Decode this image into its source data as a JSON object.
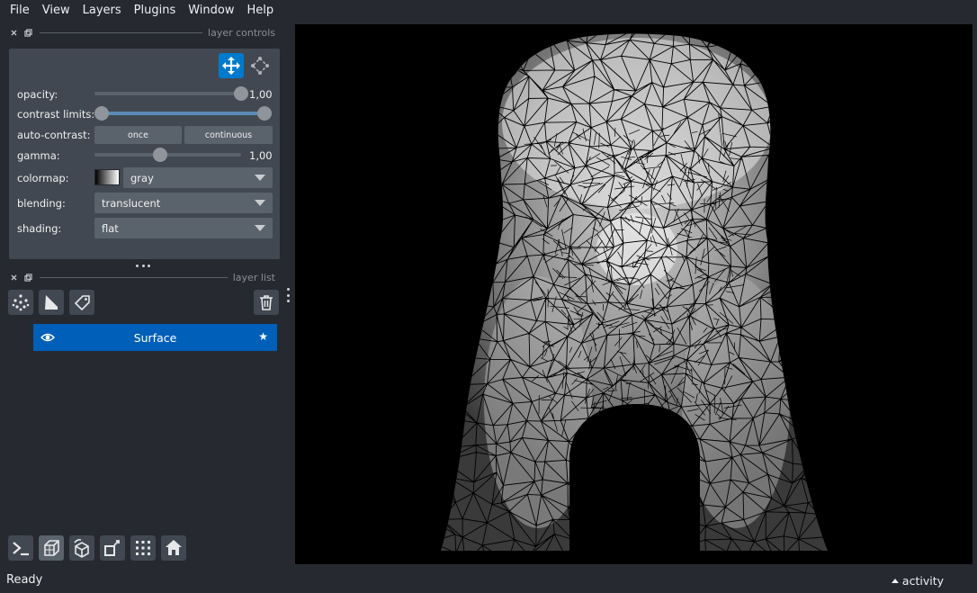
{
  "menu": [
    "File",
    "View",
    "Layers",
    "Plugins",
    "Window",
    "Help"
  ],
  "layer_controls": {
    "header": "layer controls",
    "opacity_label": "opacity:",
    "opacity_value": "1,00",
    "opacity_level": 1.0,
    "contrast_label": "contrast limits:",
    "contrast_range": [
      0.0,
      1.0
    ],
    "auto_contrast_label": "auto-contrast:",
    "once_label": "once",
    "continuous_label": "continuous",
    "gamma_label": "gamma:",
    "gamma_value": "1,00",
    "gamma_level": 0.45,
    "colormap_label": "colormap:",
    "colormap_value": "gray",
    "blending_label": "blending:",
    "blending_value": "translucent",
    "shading_label": "shading:",
    "shading_value": "flat"
  },
  "layer_list": {
    "header": "layer list",
    "layers": [
      {
        "name": "Surface",
        "visible": true,
        "selected": true
      }
    ]
  },
  "status": {
    "text": "Ready",
    "activity_label": "activity"
  },
  "colors": {
    "background": "#262930",
    "panel": "#414851",
    "accent": "#007acc",
    "selected_layer": "#005fb8",
    "canvas": "#000000"
  },
  "icons": {
    "toolbar_top": [
      "move-camera-icon",
      "transform-icon"
    ],
    "layer_buttons": [
      "new-points-icon",
      "new-shapes-icon",
      "new-labels-icon",
      "delete-layer-icon"
    ],
    "bottom_buttons": [
      "console-icon",
      "ndisplay-icon",
      "roll-dims-icon",
      "transpose-icon",
      "grid-icon",
      "home-icon"
    ]
  }
}
